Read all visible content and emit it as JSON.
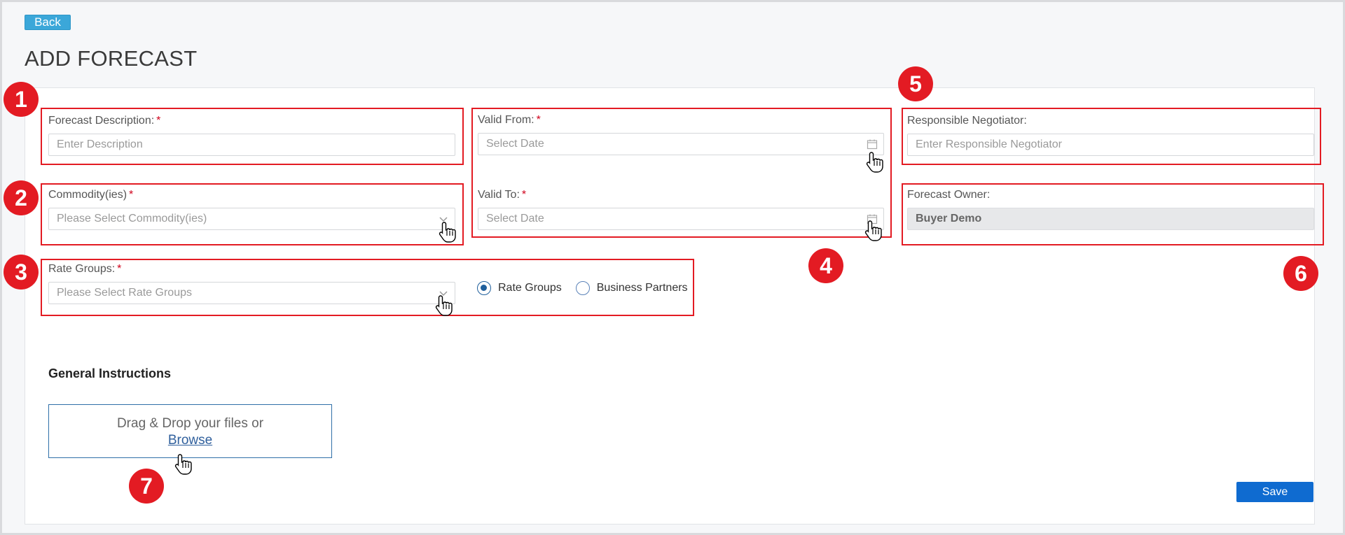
{
  "header": {
    "back_label": "Back",
    "page_title": "ADD FORECAST"
  },
  "form": {
    "description": {
      "label": "Forecast Description:",
      "required_mark": "*",
      "placeholder": "Enter Description"
    },
    "commodities": {
      "label": "Commodity(ies)",
      "required_mark": "*",
      "placeholder": "Please Select Commodity(ies)"
    },
    "rate_groups": {
      "label": "Rate Groups:",
      "required_mark": "*",
      "placeholder": "Please Select Rate Groups"
    },
    "valid_from": {
      "label": "Valid From:",
      "required_mark": "*",
      "placeholder": "Select Date"
    },
    "valid_to": {
      "label": "Valid To:",
      "required_mark": "*",
      "placeholder": "Select Date"
    },
    "negotiator": {
      "label": "Responsible Negotiator:",
      "placeholder": "Enter Responsible Negotiator"
    },
    "owner": {
      "label": "Forecast Owner:",
      "value": "Buyer Demo"
    },
    "selection_mode": {
      "options": [
        "Rate Groups",
        "Business Partners"
      ],
      "selected": "Rate Groups"
    }
  },
  "instructions": {
    "heading": "General Instructions",
    "drop_text": "Drag & Drop your files or",
    "browse_label": "Browse"
  },
  "footer": {
    "save_label": "Save"
  },
  "annotations": {
    "badges": [
      "1",
      "2",
      "3",
      "4",
      "5",
      "6",
      "7"
    ],
    "highlight_color": "#e31b23"
  },
  "colors": {
    "back_button": "#3ba7d9",
    "save_button": "#0f6bd0",
    "required": "#d0021b",
    "link": "#2f5f9c"
  }
}
